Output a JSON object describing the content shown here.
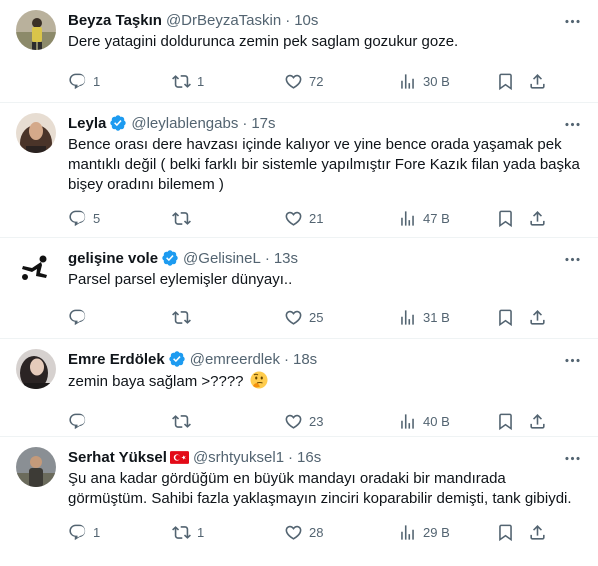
{
  "tweets": [
    {
      "name": "Beyza Taşkın",
      "handle": "@DrBeyzaTaskin",
      "time": "10s",
      "text": "Dere yatagini doldurunca zemin pek saglam gozukur goze.",
      "replies": "1",
      "retweets": "1",
      "likes": "72",
      "views": "30 B"
    },
    {
      "name": "Leyla",
      "handle": "@leylablengabs",
      "time": "17s",
      "text": "Bence orası dere havzası içinde kalıyor ve yine bence orada yaşamak pek mantıklı değil ( belki farklı bir sistemle yapılmıştır Fore Kazık filan yada başka bişey oradını bilemem )",
      "replies": "5",
      "retweets": "",
      "likes": "21",
      "views": "47 B"
    },
    {
      "name": "gelişine vole",
      "handle": "@GelisineL",
      "time": "13s",
      "text": "Parsel parsel eylemişler dünyayı..",
      "replies": "",
      "retweets": "",
      "likes": "25",
      "views": "31 B"
    },
    {
      "name": "Emre Erdölek",
      "handle": "@emreerdlek",
      "time": "18s",
      "text": "zemin baya sağlam >????",
      "replies": "",
      "retweets": "",
      "likes": "23",
      "views": "40 B"
    },
    {
      "name": "Serhat Yüksel",
      "handle": "@srhtyuksel1",
      "time": "16s",
      "text": "Şu ana kadar gördüğüm en büyük mandayı oradaki bir mandırada görmüştüm. Sahibi fazla yaklaşmayın zinciri koparabilir demişti, tank gibiydi.",
      "replies": "1",
      "retweets": "1",
      "likes": "28",
      "views": "29 B"
    }
  ],
  "ui": {
    "dot": "·"
  },
  "colors": {
    "text": "#0f1419",
    "secondary": "#536471",
    "verified": "#1d9bf0",
    "divider": "#eff3f4"
  }
}
